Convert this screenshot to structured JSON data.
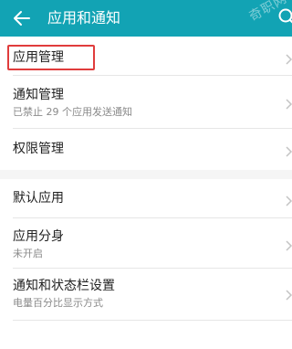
{
  "app_bar": {
    "title": "应用和通知",
    "back_icon": "arrow-left-icon",
    "search_icon": "search-icon",
    "background": "#12a3b4",
    "watermark": "奇职网"
  },
  "group1": {
    "items": [
      {
        "title": "应用管理",
        "subtitle": ""
      },
      {
        "title": "通知管理",
        "subtitle": "已禁止 29 个应用发送通知"
      },
      {
        "title": "权限管理",
        "subtitle": ""
      }
    ]
  },
  "group2": {
    "items": [
      {
        "title": "默认应用",
        "subtitle": ""
      },
      {
        "title": "应用分身",
        "subtitle": "未开启"
      },
      {
        "title": "通知和状态栏设置",
        "subtitle": "电量百分比显示方式"
      }
    ]
  },
  "highlight": {
    "color": "#e03c3c",
    "target": "应用管理"
  }
}
